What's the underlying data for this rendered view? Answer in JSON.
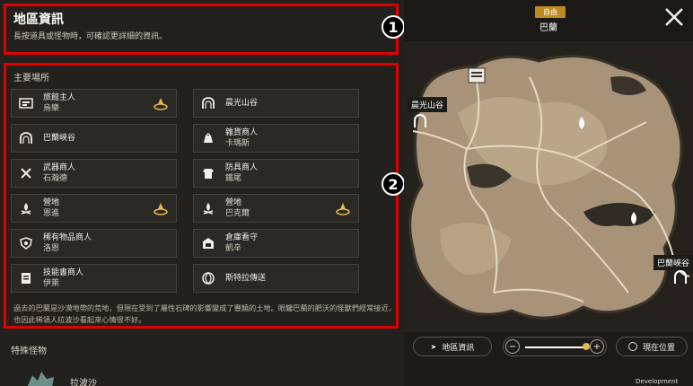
{
  "header": {
    "title": "地區資訊",
    "subtitle": "長按道具或怪物時，可確認更詳細的資訊。"
  },
  "annotations": {
    "one": "1",
    "two": "2"
  },
  "main_places": {
    "title": "主要場所",
    "items": [
      {
        "line1": "旅館主人",
        "line2": "烏樂",
        "icon": "inn-icon",
        "quest": true
      },
      {
        "line1": "晨光山谷",
        "line2": "",
        "icon": "gate-icon",
        "quest": false
      },
      {
        "line1": "巴蘭峽谷",
        "line2": "",
        "icon": "gate-icon",
        "quest": false
      },
      {
        "line1": "雜貨商人",
        "line2": "卡瑪斯",
        "icon": "bag-icon",
        "quest": false
      },
      {
        "line1": "武器商人",
        "line2": "石瀚德",
        "icon": "swords-icon",
        "quest": false
      },
      {
        "line1": "防具商人",
        "line2": "鐵尾",
        "icon": "armor-icon",
        "quest": false
      },
      {
        "line1": "營地",
        "line2": "恩進",
        "icon": "campfire-icon",
        "quest": true
      },
      {
        "line1": "營地",
        "line2": "巴克爾",
        "icon": "campfire-icon",
        "quest": true
      },
      {
        "line1": "稀有物品商人",
        "line2": "洛恩",
        "icon": "shield-icon",
        "quest": false
      },
      {
        "line1": "倉庫看守",
        "line2": "凱辛",
        "icon": "storage-icon",
        "quest": false
      },
      {
        "line1": "技能書商人",
        "line2": "伊萊",
        "icon": "book-icon",
        "quest": false
      },
      {
        "line1": "斯特拉傳送",
        "line2": "",
        "icon": "portal-icon",
        "quest": false
      }
    ],
    "description": "過去的巴蘭是沙漠地帶的荒地，但現在受到了屬性石碑的影響變成了豐饒的土地。眼饞巴蘭的肥沃的怪獸們經常接近，也因此稀領人拉波沙看起來心情很不好。"
  },
  "special_monsters": {
    "title": "特殊怪物",
    "first": "拉波沙"
  },
  "top": {
    "tag": "自由",
    "region": "巴蘭"
  },
  "map": {
    "label_dawn_valley": "晨光山谷",
    "label_balan_canyon": "巴蘭峽谷"
  },
  "controls": {
    "region_info": "地區資訊",
    "current_pos": "現在位置",
    "zoom": 0.95,
    "minus": "−",
    "plus": "+"
  },
  "footer": {
    "dev_build": "Development Build"
  }
}
